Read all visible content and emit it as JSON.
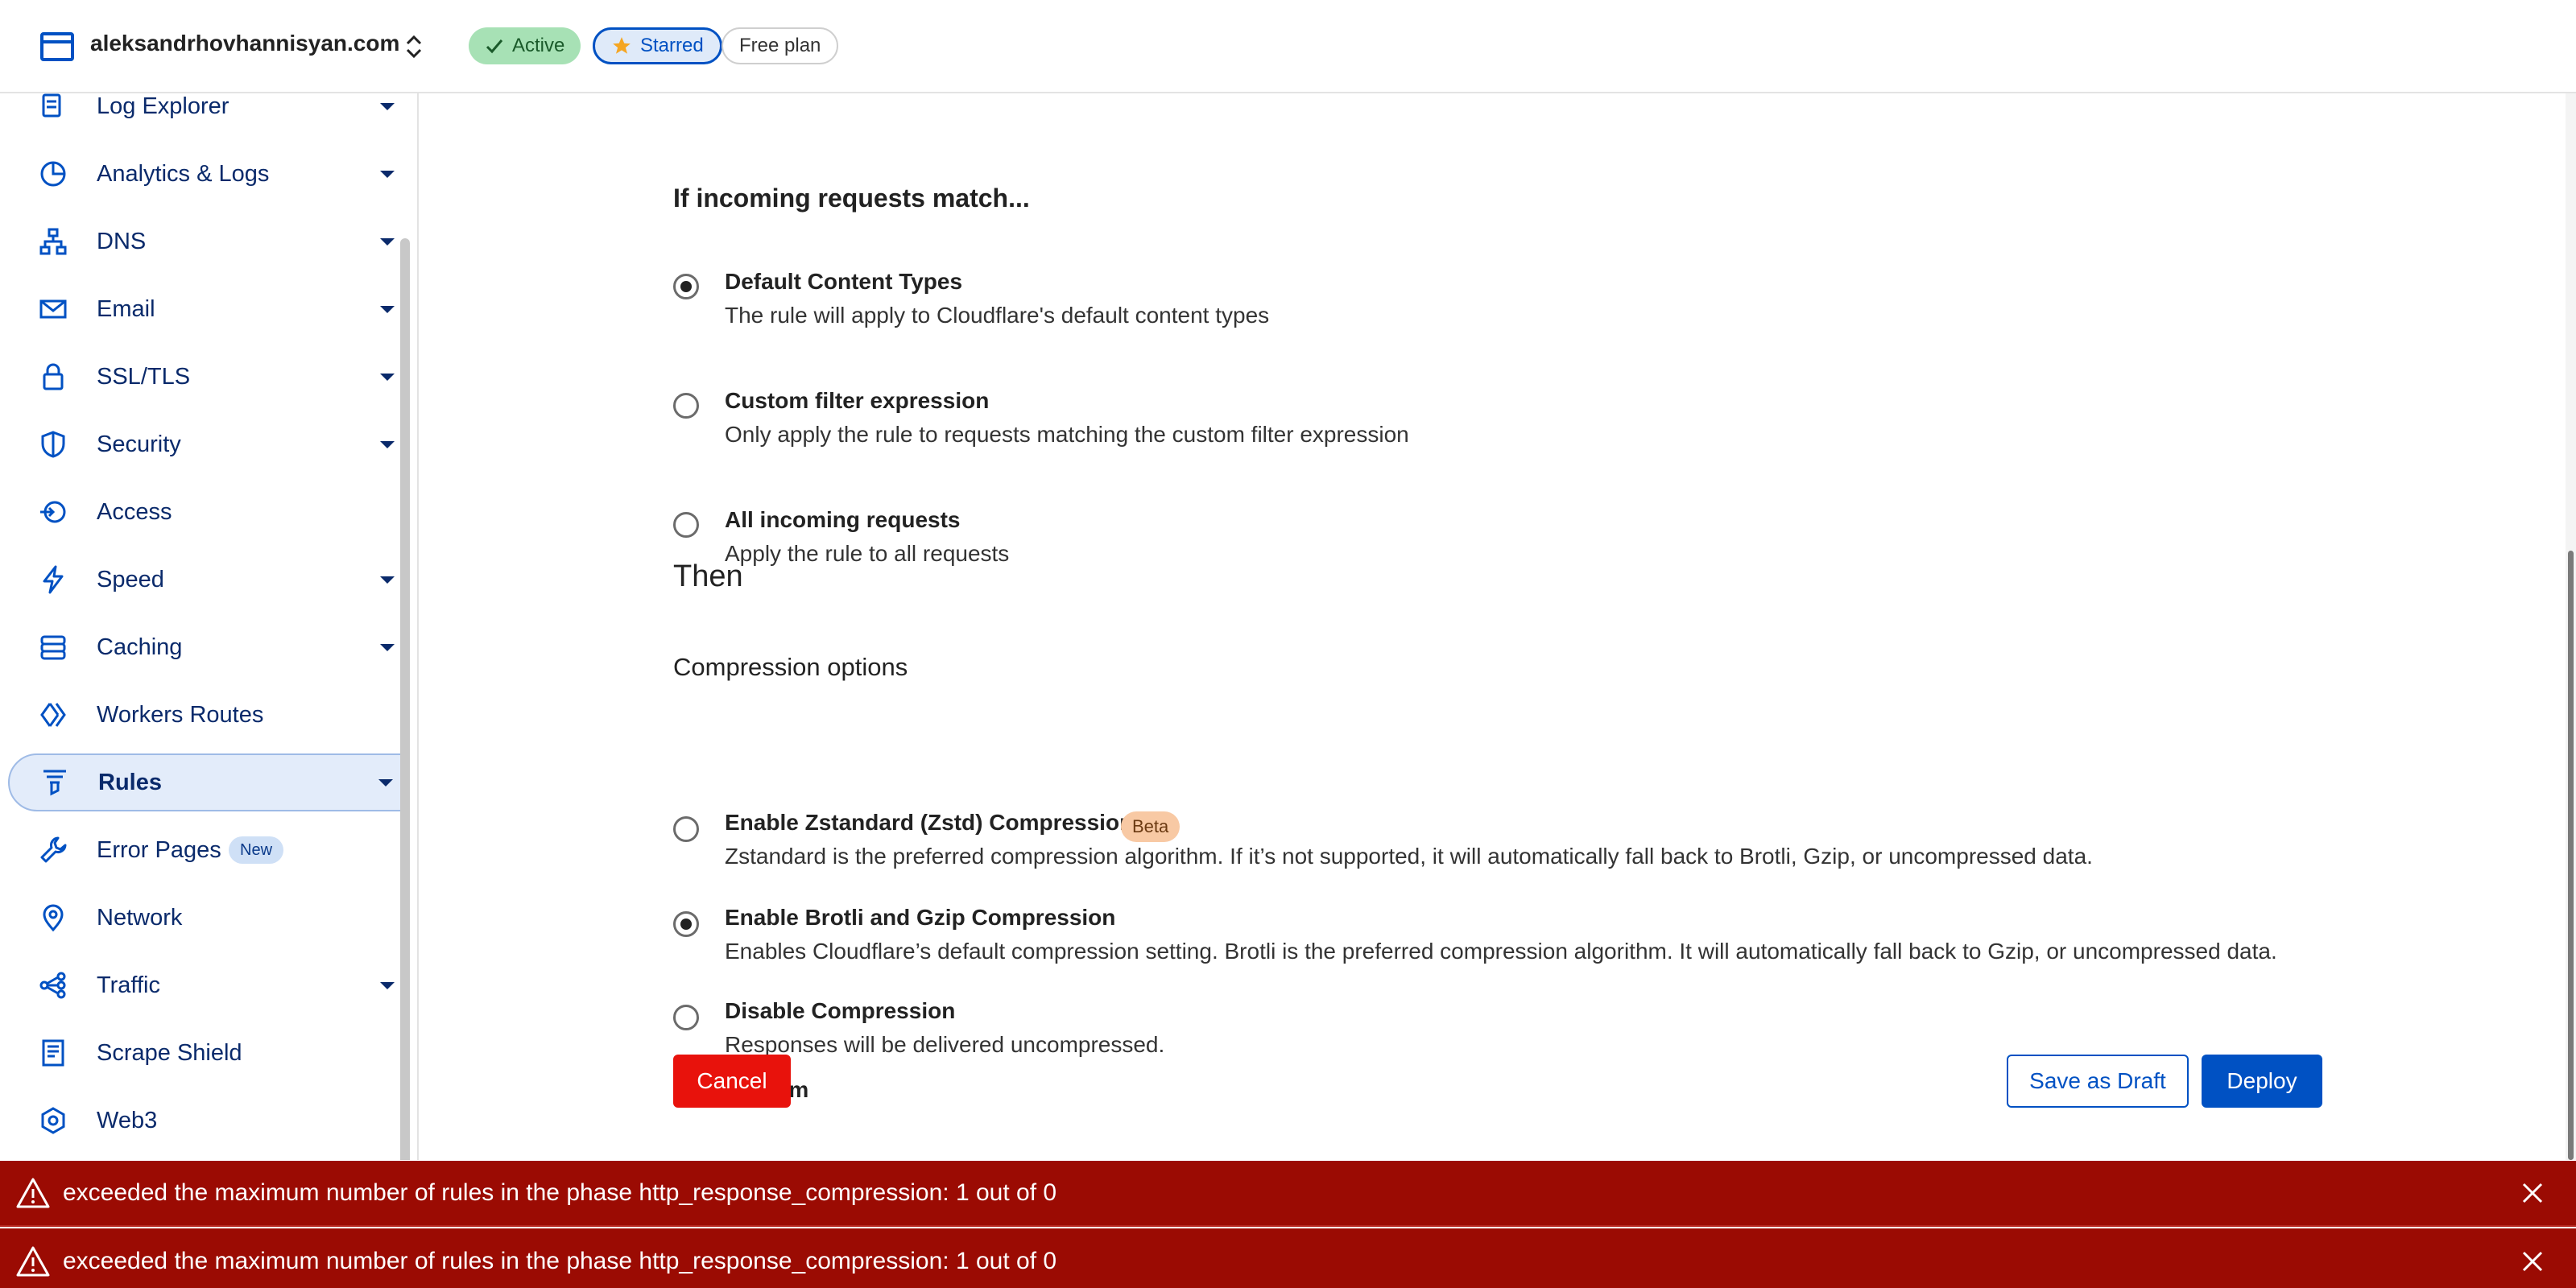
{
  "header": {
    "site_name": "aleksandrhovhannisyan.com",
    "badges": {
      "active": "Active",
      "starred": "Starred",
      "plan": "Free plan"
    }
  },
  "sidebar": {
    "items": [
      {
        "label": "Log Explorer",
        "icon": "log-explorer-icon",
        "expandable": true
      },
      {
        "label": "Analytics & Logs",
        "icon": "pie-chart-icon",
        "expandable": true
      },
      {
        "label": "DNS",
        "icon": "network-tree-icon",
        "expandable": true
      },
      {
        "label": "Email",
        "icon": "envelope-icon",
        "expandable": true
      },
      {
        "label": "SSL/TLS",
        "icon": "lock-icon",
        "expandable": true
      },
      {
        "label": "Security",
        "icon": "shield-icon",
        "expandable": true
      },
      {
        "label": "Access",
        "icon": "access-icon",
        "expandable": false
      },
      {
        "label": "Speed",
        "icon": "lightning-icon",
        "expandable": true
      },
      {
        "label": "Caching",
        "icon": "server-stack-icon",
        "expandable": true
      },
      {
        "label": "Workers Routes",
        "icon": "workers-icon",
        "expandable": false
      },
      {
        "label": "Rules",
        "icon": "funnel-icon",
        "expandable": true,
        "selected": true
      },
      {
        "label": "Error Pages",
        "icon": "wrench-icon",
        "expandable": false,
        "badge": "New"
      },
      {
        "label": "Network",
        "icon": "location-pin-icon",
        "expandable": false
      },
      {
        "label": "Traffic",
        "icon": "traffic-icon",
        "expandable": true
      },
      {
        "label": "Scrape Shield",
        "icon": "document-icon",
        "expandable": false
      },
      {
        "label": "Web3",
        "icon": "web3-icon",
        "expandable": false
      }
    ]
  },
  "main": {
    "match_heading": "If incoming requests match...",
    "match_options": [
      {
        "title": "Default Content Types",
        "desc": "The rule will apply to Cloudflare's default content types",
        "checked": true
      },
      {
        "title": "Custom filter expression",
        "desc": "Only apply the rule to requests matching the custom filter expression",
        "checked": false
      },
      {
        "title": "All incoming requests",
        "desc": "Apply the rule to all requests",
        "checked": false
      }
    ],
    "then_heading": "Then",
    "compression_heading": "Compression options",
    "compression_options": [
      {
        "title": "Enable Zstandard (Zstd) Compression",
        "badge": "Beta",
        "desc": "Zstandard is the preferred compression algorithm. If it’s not supported, it will automatically fall back to Brotli, Gzip, or uncompressed data.",
        "checked": false
      },
      {
        "title": "Enable Brotli and Gzip Compression",
        "desc": "Enables Cloudflare’s default compression setting. Brotli is the preferred compression algorithm. It will automatically fall back to Gzip, or uncompressed data.",
        "checked": true
      },
      {
        "title": "Disable Compression",
        "desc": "Responses will be delivered uncompressed.",
        "checked": false
      },
      {
        "title": "Custom",
        "desc": "",
        "checked": false
      }
    ],
    "buttons": {
      "cancel": "Cancel",
      "save_draft": "Save as Draft",
      "deploy": "Deploy"
    }
  },
  "errors": [
    "exceeded the maximum number of rules in the phase http_response_compression: 1 out of 0",
    "exceeded the maximum number of rules in the phase http_response_compression: 1 out of 0"
  ],
  "colors": {
    "accent": "#0051c3",
    "danger": "#e8120c",
    "error_banner": "#9b0b03",
    "active_badge": "#a7e1b5",
    "beta_badge": "#f8c9a4"
  }
}
